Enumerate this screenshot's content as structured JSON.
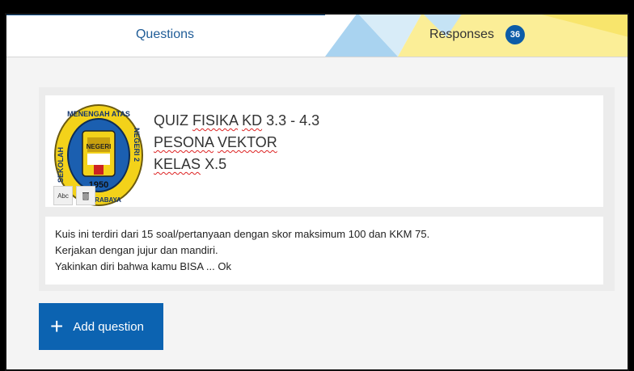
{
  "tabs": {
    "questions_label": "Questions",
    "responses_label": "Responses",
    "responses_count": "36"
  },
  "form": {
    "title_lines": [
      "QUIZ FISIKA KD 3.3 - 4.3",
      "PESONA VEKTOR",
      "KELAS X.5"
    ],
    "description_lines": [
      "Kuis ini terdiri dari 15 soal/pertanyaan dengan skor maksimum 100 dan KKM 75.",
      "Kerjakan dengan jujur dan mandiri.",
      "Yakinkan diri bahwa kamu BISA ... Ok"
    ],
    "logo_text": {
      "top": "MENENGAH ATAS",
      "left": "SEKOLAH",
      "right": "NEGERI 2",
      "year": "1950",
      "bottom": "SURABAYA",
      "center": "NEGERI"
    }
  },
  "tools": {
    "alt_text_label": "Abc"
  },
  "actions": {
    "add_question_label": "Add question"
  },
  "colors": {
    "accent": "#0c63b1",
    "badge": "#0c5ca8",
    "tab_active": "#1f5c97",
    "logo_yellow": "#f3d21a",
    "logo_blue": "#1b5fb0"
  },
  "icons": {
    "image_tools": [
      "alt-text-icon",
      "trash-icon"
    ],
    "add": "plus-icon"
  }
}
